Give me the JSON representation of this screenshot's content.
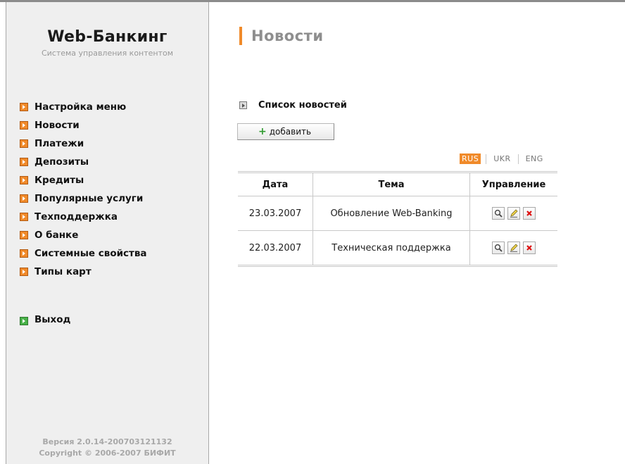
{
  "sidebar": {
    "brand_title": "Web-Банкинг",
    "brand_subtitle": "Система управления контентом",
    "menu": [
      {
        "label": "Настройка меню"
      },
      {
        "label": "Новости"
      },
      {
        "label": "Платежи"
      },
      {
        "label": "Депозиты"
      },
      {
        "label": "Кредиты"
      },
      {
        "label": "Популярные услуги"
      },
      {
        "label": "Техподдержка"
      },
      {
        "label": "О банке"
      },
      {
        "label": "Системные свойства"
      },
      {
        "label": "Типы карт"
      }
    ],
    "logout_label": "Выход",
    "version": "Версия 2.0.14-200703121132",
    "copyright": "Copyright © 2006-2007 БИФИТ"
  },
  "main": {
    "title": "Новости",
    "section_title": "Список новостей",
    "add_button": "добавить",
    "languages": [
      "RUS",
      "UKR",
      "ENG"
    ],
    "active_language": "RUS",
    "table": {
      "headers": [
        "Дата",
        "Тема",
        "Управление"
      ],
      "rows": [
        {
          "date": "23.03.2007",
          "topic": "Обновление Web-Banking"
        },
        {
          "date": "22.03.2007",
          "topic": "Техническая поддержка"
        }
      ]
    }
  },
  "colors": {
    "accent": "#f08a2a",
    "logout_bullet": "#48b048",
    "sidebar_bg": "#efefef"
  },
  "icons": [
    "menu-bullet-icon",
    "section-arrow-icon",
    "plus-icon",
    "view-icon",
    "edit-icon",
    "delete-icon"
  ]
}
